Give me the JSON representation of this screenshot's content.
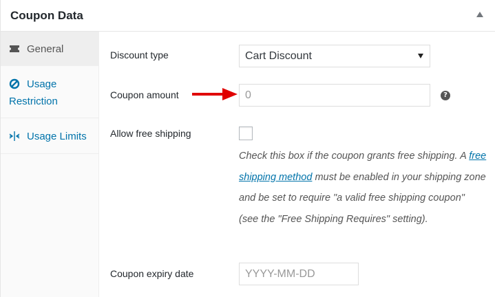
{
  "header": {
    "title": "Coupon Data",
    "toggle_icon": "triangle-up-icon"
  },
  "sidebar": {
    "tabs": [
      {
        "label": "General",
        "icon": "ticket-icon",
        "active": true
      },
      {
        "label_line1": "Usage",
        "label_line2": "Restriction",
        "icon": "no-entry-circle-icon",
        "active": false
      },
      {
        "label": "Usage Limits",
        "icon": "compress-arrows-icon",
        "active": false
      }
    ]
  },
  "fields": {
    "discount_type": {
      "label": "Discount type",
      "value": "Cart Discount"
    },
    "coupon_amount": {
      "label": "Coupon amount",
      "placeholder": "0",
      "help_icon": "question-mark-icon"
    },
    "free_shipping": {
      "label": "Allow free shipping",
      "checked": false,
      "desc_before": "Check this box if the coupon grants free shipping. A ",
      "desc_link": "free shipping method",
      "desc_after": " must be enabled in your shipping zone and be set to require \"a valid free shipping coupon\" (see the \"Free Shipping Requires\" setting)."
    },
    "expiry_date": {
      "label": "Coupon expiry date",
      "placeholder": "YYYY-MM-DD"
    }
  },
  "colors": {
    "link": "#0073aa",
    "arrow": "#e00000",
    "active_tab_bg": "#eeeeee"
  }
}
